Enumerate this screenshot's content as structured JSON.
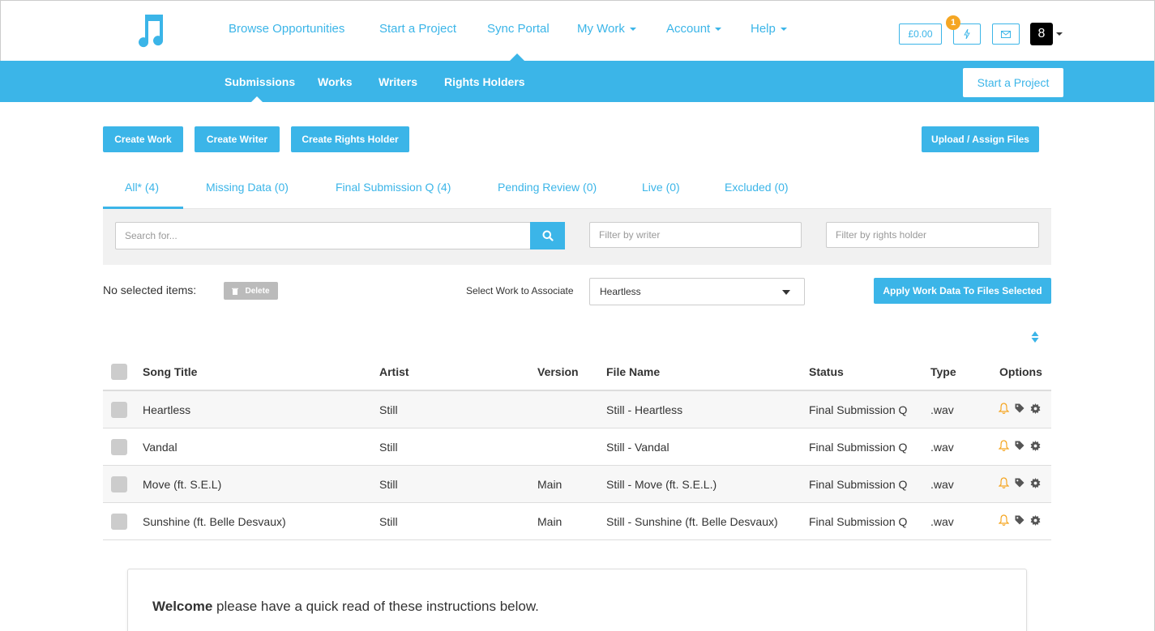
{
  "colors": {
    "accent": "#3bb5e8",
    "bell": "#f5a623",
    "muted": "#bbbbbb"
  },
  "nav": {
    "logo_icon": "music-note-icon",
    "items": [
      {
        "label": "Browse Opportunities"
      },
      {
        "label": "Start a Project"
      },
      {
        "label": "Sync Portal"
      },
      {
        "label": "My Work"
      },
      {
        "label": "Account"
      },
      {
        "label": "Help"
      }
    ],
    "balance": "£0.00",
    "notification_count": "1",
    "avatar_glyph": "8"
  },
  "subnav": {
    "items": [
      {
        "label": "Submissions"
      },
      {
        "label": "Works"
      },
      {
        "label": "Writers"
      },
      {
        "label": "Rights Holders"
      }
    ],
    "start_project": "Start a Project"
  },
  "actions": {
    "create_work": "Create Work",
    "create_writer": "Create Writer",
    "create_rights_holder": "Create Rights Holder",
    "upload_assign": "Upload / Assign Files"
  },
  "tabs": [
    {
      "label": "All* (4)"
    },
    {
      "label": "Missing Data (0)"
    },
    {
      "label": "Final Submission Q (4)"
    },
    {
      "label": "Pending Review (0)"
    },
    {
      "label": "Live (0)"
    },
    {
      "label": "Excluded (0)"
    }
  ],
  "filters": {
    "search_placeholder": "Search for...",
    "writer_placeholder": "Filter by writer",
    "rights_placeholder": "Filter by rights holder"
  },
  "selection": {
    "label": "No selected items:",
    "delete": "Delete",
    "associate_label": "Select Work to Associate",
    "associate_value": "Heartless",
    "apply": "Apply Work Data To Files Selected"
  },
  "table": {
    "headers": [
      "Song Title",
      "Artist",
      "Version",
      "File Name",
      "Status",
      "Type",
      "Options"
    ],
    "rows": [
      {
        "title": "Heartless",
        "artist": "Still",
        "version": "",
        "file": "Still - Heartless",
        "status": "Final Submission Q",
        "type": ".wav"
      },
      {
        "title": "Vandal",
        "artist": "Still",
        "version": "",
        "file": "Still - Vandal",
        "status": "Final Submission Q",
        "type": ".wav"
      },
      {
        "title": "Move (ft. S.E.L)",
        "artist": "Still",
        "version": "Main",
        "file": "Still - Move (ft. S.E.L.)",
        "status": "Final Submission Q",
        "type": ".wav"
      },
      {
        "title": "Sunshine (ft. Belle Desvaux)",
        "artist": "Still",
        "version": "Main",
        "file": "Still - Sunshine (ft. Belle Desvaux)",
        "status": "Final Submission Q",
        "type": ".wav"
      }
    ]
  },
  "welcome": {
    "bold": "Welcome",
    "text": " please have a quick read of these instructions below."
  }
}
